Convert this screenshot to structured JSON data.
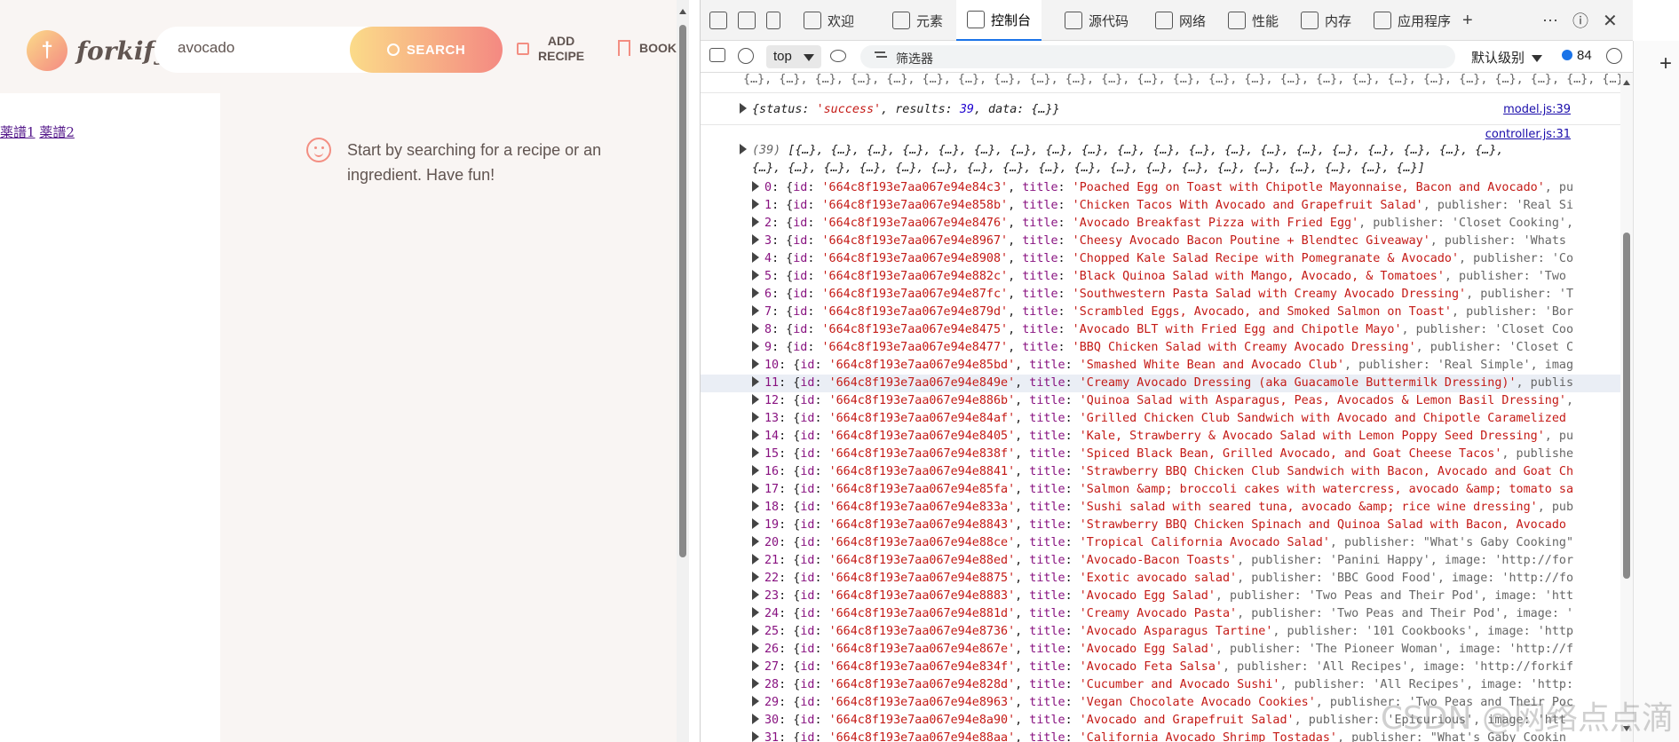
{
  "app": {
    "logo_text": "forkify",
    "logo_mark": "fork-knife-icon",
    "search_value": "avocado",
    "search_button": "SEARCH",
    "add_recipe_line1": "ADD",
    "add_recipe_line2": "RECIPE",
    "bookmarks": "BOOK",
    "links": [
      "薬譜1",
      "薬譜2"
    ],
    "message": "Start by searching for a recipe or an ingredient. Have fun!"
  },
  "devtools": {
    "tabs": [
      "欢迎",
      "元素",
      "控制台",
      "源代码",
      "网络",
      "性能",
      "内存",
      "应用程序"
    ],
    "active_tab": "控制台",
    "context": "top",
    "filter_placeholder": "筛选器",
    "level": "默认级别",
    "issues_count": "84",
    "top_line": "{…}, {…}, {…}, {…}, {…}, {…}, {…}, {…}, {…}, {…}, {…}, {…}, {…}, {…}, {…}, {…}, {…}, {…}, {…}, {…}, {…}, {…}, {…}, {…}, {…}, {…}, {…}, {…}, {…}]",
    "status_line": {
      "prefix": "{status: ",
      "status": "'success'",
      "mid": ", results: ",
      "results": "39",
      "suffix": ", data: {…}}",
      "src": "model.js:39"
    },
    "array_header": {
      "count": "(39)",
      "line1": "[{…}, {…}, {…}, {…}, {…}, {…}, {…}, {…}, {…}, {…}, {…}, {…}, {…}, {…}, {…}, {…}, {…}, {…}, {…}, {…},",
      "line2": "{…}, {…}, {…}, {…}, {…}, {…}, {…}, {…}, {…}, {…}, {…}, {…}, {…}, {…}, {…}, {…}, {…}, {…}, {…}]",
      "src": "controller.js:31"
    },
    "items": [
      {
        "i": "0",
        "id": "'664c8f193e7aa067e94e84c3'",
        "title": "'Poached Egg on Toast with Chipotle Mayonnaise, Bacon and Avocado'",
        "tail": ", pu"
      },
      {
        "i": "1",
        "id": "'664c8f193e7aa067e94e858b'",
        "title": "'Chicken Tacos With Avocado and Grapefruit Salad'",
        "tail": ", publisher: 'Real Si"
      },
      {
        "i": "2",
        "id": "'664c8f193e7aa067e94e8476'",
        "title": "'Avocado Breakfast Pizza with Fried Egg'",
        "tail": ", publisher: 'Closet Cooking',"
      },
      {
        "i": "3",
        "id": "'664c8f193e7aa067e94e8967'",
        "title": "'Cheesy Avocado Bacon Poutine + Blendtec Giveaway'",
        "tail": ", publisher: 'Whats"
      },
      {
        "i": "4",
        "id": "'664c8f193e7aa067e94e8908'",
        "title": "'Chopped Kale Salad Recipe with Pomegranate & Avocado'",
        "tail": ", publisher: 'Co"
      },
      {
        "i": "5",
        "id": "'664c8f193e7aa067e94e882c'",
        "title": "'Black Quinoa Salad with Mango, Avocado, & Tomatoes'",
        "tail": ", publisher: 'Two"
      },
      {
        "i": "6",
        "id": "'664c8f193e7aa067e94e87fc'",
        "title": "'Southwestern Pasta Salad with Creamy Avocado Dressing'",
        "tail": ", publisher: 'T"
      },
      {
        "i": "7",
        "id": "'664c8f193e7aa067e94e879d'",
        "title": "'Scrambled Eggs, Avocado, and Smoked Salmon on Toast'",
        "tail": ", publisher: 'Bor"
      },
      {
        "i": "8",
        "id": "'664c8f193e7aa067e94e8475'",
        "title": "'Avocado BLT with Fried Egg and Chipotle Mayo'",
        "tail": ", publisher: 'Closet Coo"
      },
      {
        "i": "9",
        "id": "'664c8f193e7aa067e94e8477'",
        "title": "'BBQ Chicken Salad with Creamy Avocado Dressing'",
        "tail": ", publisher: 'Closet C"
      },
      {
        "i": "10",
        "id": "'664c8f193e7aa067e94e85bd'",
        "title": "'Smashed White Bean and Avocado Club'",
        "tail": ", publisher: 'Real Simple', imag"
      },
      {
        "i": "11",
        "id": "'664c8f193e7aa067e94e849e'",
        "title": "'Creamy Avocado Dressing (aka Guacamole Buttermilk Dressing)'",
        "tail": ", publis"
      },
      {
        "i": "12",
        "id": "'664c8f193e7aa067e94e886b'",
        "title": "'Quinoa Salad with Asparagus, Peas, Avocados & Lemon Basil Dressing'",
        "tail": ","
      },
      {
        "i": "13",
        "id": "'664c8f193e7aa067e94e84af'",
        "title": "'Grilled Chicken Club Sandwich with Avocado and Chipotle Caramelized",
        "tail": ""
      },
      {
        "i": "14",
        "id": "'664c8f193e7aa067e94e8405'",
        "title": "'Kale, Strawberry & Avocado Salad with Lemon Poppy Seed Dressing'",
        "tail": ", pu"
      },
      {
        "i": "15",
        "id": "'664c8f193e7aa067e94e838f'",
        "title": "'Spiced Black Bean, Grilled Avocado, and Goat Cheese Tacos'",
        "tail": ", publishe"
      },
      {
        "i": "16",
        "id": "'664c8f193e7aa067e94e8841'",
        "title": "'Strawberry BBQ Chicken Club Sandwich with Bacon, Avocado and Goat Ch",
        "tail": ""
      },
      {
        "i": "17",
        "id": "'664c8f193e7aa067e94e85fa'",
        "title": "'Salmon &amp; broccoli cakes with watercress, avocado &amp; tomato sa",
        "tail": ""
      },
      {
        "i": "18",
        "id": "'664c8f193e7aa067e94e833a'",
        "title": "'Sushi salad with seared tuna, avocado &amp; rice wine dressing'",
        "tail": ", pub"
      },
      {
        "i": "19",
        "id": "'664c8f193e7aa067e94e8843'",
        "title": "'Strawberry BBQ Chicken Spinach and Quinoa Salad with Bacon, Avocado",
        "tail": ""
      },
      {
        "i": "20",
        "id": "'664c8f193e7aa067e94e88ce'",
        "title": "'Tropical California Avocado Salad'",
        "tail": ", publisher: \"What's Gaby Cooking\""
      },
      {
        "i": "21",
        "id": "'664c8f193e7aa067e94e88ed'",
        "title": "'Avocado-Bacon Toasts'",
        "tail": ", publisher: 'Panini Happy', image: 'http://for"
      },
      {
        "i": "22",
        "id": "'664c8f193e7aa067e94e8875'",
        "title": "'Exotic avocado salad'",
        "tail": ", publisher: 'BBC Good Food', image: 'http://fo"
      },
      {
        "i": "23",
        "id": "'664c8f193e7aa067e94e8883'",
        "title": "'Avocado Egg Salad'",
        "tail": ", publisher: 'Two Peas and Their Pod', image: 'htt"
      },
      {
        "i": "24",
        "id": "'664c8f193e7aa067e94e881d'",
        "title": "'Creamy Avocado Pasta'",
        "tail": ", publisher: 'Two Peas and Their Pod', image: '"
      },
      {
        "i": "25",
        "id": "'664c8f193e7aa067e94e8736'",
        "title": "'Avocado Asparagus Tartine'",
        "tail": ", publisher: '101 Cookbooks', image: 'http"
      },
      {
        "i": "26",
        "id": "'664c8f193e7aa067e94e867e'",
        "title": "'Avocado Egg Salad'",
        "tail": ", publisher: 'The Pioneer Woman', image: 'http://f"
      },
      {
        "i": "27",
        "id": "'664c8f193e7aa067e94e834f'",
        "title": "'Avocado Feta Salsa'",
        "tail": ", publisher: 'All Recipes', image: 'http://forkif"
      },
      {
        "i": "28",
        "id": "'664c8f193e7aa067e94e828d'",
        "title": "'Cucumber and Avocado Sushi'",
        "tail": ", publisher: 'All Recipes', image: 'http:"
      },
      {
        "i": "29",
        "id": "'664c8f193e7aa067e94e8963'",
        "title": "'Vegan Chocolate Avocado Cookies'",
        "tail": ", publisher: 'Two Peas and Their Poc"
      },
      {
        "i": "30",
        "id": "'664c8f193e7aa067e94e8a90'",
        "title": "'Avocado and Grapefruit Salad'",
        "tail": ", publisher: 'Epicurious', image: 'htt"
      },
      {
        "i": "31",
        "id": "'664c8f193e7aa067e94e88aa'",
        "title": "'California Avocado Shrimp Tostadas'",
        "tail": ", publisher: \"What's Gaby Cookin"
      }
    ],
    "highlighted_index": 11,
    "watermark": "CSDN @网络点点滴"
  }
}
